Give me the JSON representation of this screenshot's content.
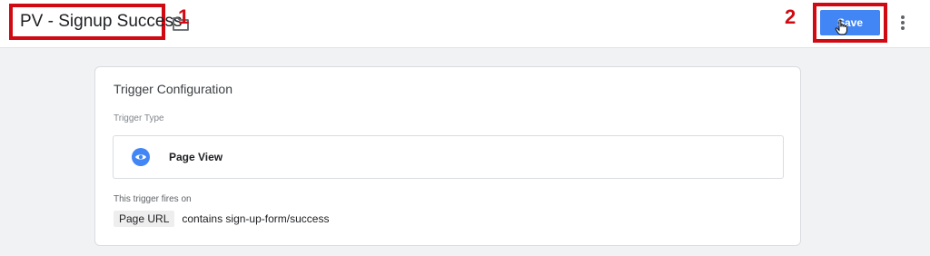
{
  "header": {
    "tag_name": "PV - Signup Success",
    "annotation_1": "1",
    "annotation_2": "2",
    "save_label": "Save"
  },
  "card": {
    "title": "Trigger Configuration",
    "trigger_type_label": "Trigger Type",
    "trigger_type_value": "Page View",
    "fires_on_label": "This trigger fires on",
    "condition": {
      "variable": "Page URL",
      "operator_value": "contains sign-up-form/success"
    }
  },
  "colors": {
    "accent": "#4285f4",
    "annotation": "#d00a12",
    "background": "#f1f2f3"
  },
  "icons": {
    "folder": "folder-icon",
    "cursor": "hand-cursor-icon",
    "more": "more-vert-icon",
    "trigger": "eye-icon"
  }
}
